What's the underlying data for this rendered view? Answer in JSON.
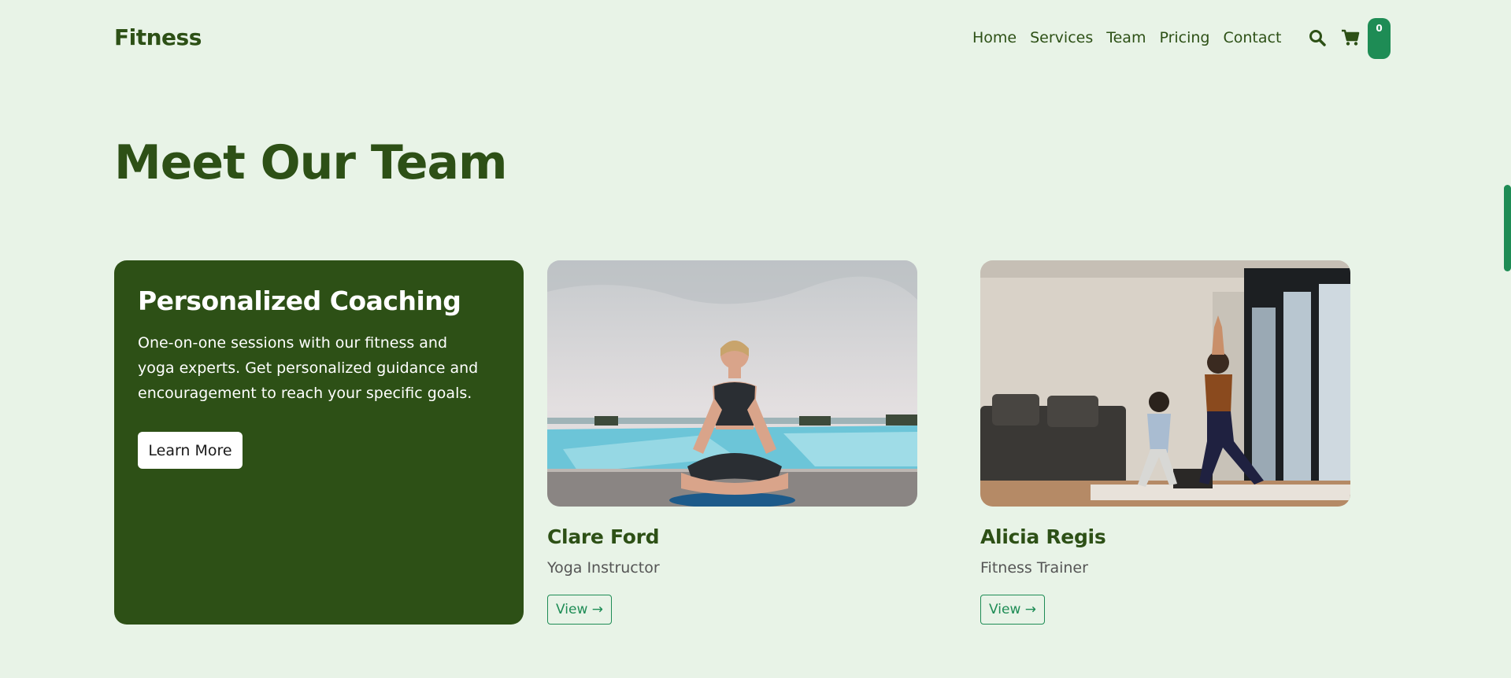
{
  "brand": "Fitness",
  "nav": {
    "home": "Home",
    "services": "Services",
    "team": "Team",
    "pricing": "Pricing",
    "contact": "Contact"
  },
  "cart": {
    "count": "0"
  },
  "page_title": "Meet Our Team",
  "coaching": {
    "title": "Personalized Coaching",
    "text": "One-on-one sessions with our fitness and yoga experts. Get personalized guidance and encouragement to reach your specific goals.",
    "button": "Learn More"
  },
  "team": [
    {
      "name": "Clare Ford",
      "role": "Yoga Instructor",
      "button": "View →"
    },
    {
      "name": "Alicia Regis",
      "role": "Fitness Trainer",
      "button": "View →"
    }
  ],
  "icons": {
    "search": "search-icon",
    "cart": "cart-icon"
  },
  "colors": {
    "background": "#e8f3e7",
    "primary": "#2d5016",
    "accent": "#1e8c55"
  }
}
